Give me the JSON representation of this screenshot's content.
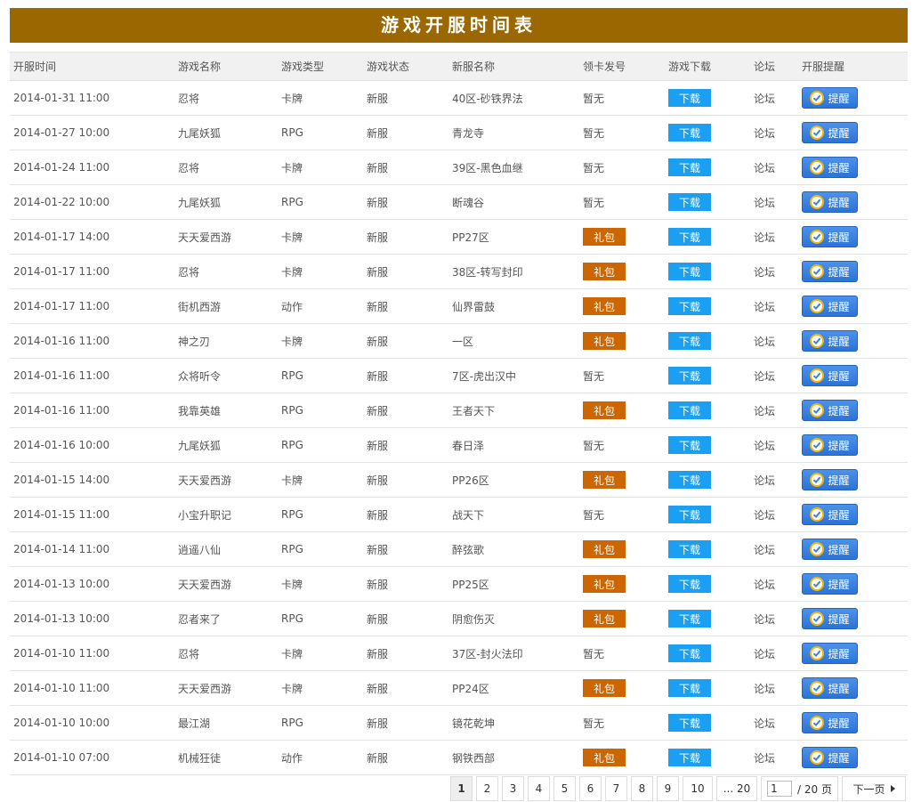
{
  "title": "游戏开服时间表",
  "columns": [
    "开服时间",
    "游戏名称",
    "游戏类型",
    "游戏状态",
    "新服名称",
    "领卡发号",
    "游戏下载",
    "论坛",
    "开服提醒"
  ],
  "labels": {
    "none": "暂无",
    "gift": "礼包",
    "download": "下载",
    "forum": "论坛",
    "remind": "提醒"
  },
  "rows": [
    {
      "time": "2014-01-31 11:00",
      "game": "忍将",
      "type": "卡牌",
      "status": "新服",
      "server": "40区-砂铁界法",
      "card": "none"
    },
    {
      "time": "2014-01-27 10:00",
      "game": "九尾妖狐",
      "type": "RPG",
      "status": "新服",
      "server": "青龙寺",
      "card": "none"
    },
    {
      "time": "2014-01-24 11:00",
      "game": "忍将",
      "type": "卡牌",
      "status": "新服",
      "server": "39区-黑色血继",
      "card": "none"
    },
    {
      "time": "2014-01-22 10:00",
      "game": "九尾妖狐",
      "type": "RPG",
      "status": "新服",
      "server": "断魂谷",
      "card": "none"
    },
    {
      "time": "2014-01-17 14:00",
      "game": "天天爱西游",
      "type": "卡牌",
      "status": "新服",
      "server": "PP27区",
      "card": "gift"
    },
    {
      "time": "2014-01-17 11:00",
      "game": "忍将",
      "type": "卡牌",
      "status": "新服",
      "server": "38区-转写封印",
      "card": "gift"
    },
    {
      "time": "2014-01-17 11:00",
      "game": "街机西游",
      "type": "动作",
      "status": "新服",
      "server": "仙界雷鼓",
      "card": "gift"
    },
    {
      "time": "2014-01-16 11:00",
      "game": "神之刃",
      "type": "卡牌",
      "status": "新服",
      "server": "一区",
      "card": "gift"
    },
    {
      "time": "2014-01-16 11:00",
      "game": "众将听令",
      "type": "RPG",
      "status": "新服",
      "server": "7区-虎出汉中",
      "card": "none"
    },
    {
      "time": "2014-01-16 11:00",
      "game": "我靠英雄",
      "type": "RPG",
      "status": "新服",
      "server": "王者天下",
      "card": "gift"
    },
    {
      "time": "2014-01-16 10:00",
      "game": "九尾妖狐",
      "type": "RPG",
      "status": "新服",
      "server": "春日泽",
      "card": "none"
    },
    {
      "time": "2014-01-15 14:00",
      "game": "天天爱西游",
      "type": "卡牌",
      "status": "新服",
      "server": "PP26区",
      "card": "gift"
    },
    {
      "time": "2014-01-15 11:00",
      "game": "小宝升职记",
      "type": "RPG",
      "status": "新服",
      "server": "战天下",
      "card": "none"
    },
    {
      "time": "2014-01-14 11:00",
      "game": "逍遥八仙",
      "type": "RPG",
      "status": "新服",
      "server": "醉弦歌",
      "card": "gift"
    },
    {
      "time": "2014-01-13 10:00",
      "game": "天天爱西游",
      "type": "卡牌",
      "status": "新服",
      "server": "PP25区",
      "card": "gift"
    },
    {
      "time": "2014-01-13 10:00",
      "game": "忍者来了",
      "type": "RPG",
      "status": "新服",
      "server": "阴愈伤灭",
      "card": "gift"
    },
    {
      "time": "2014-01-10 11:00",
      "game": "忍将",
      "type": "卡牌",
      "status": "新服",
      "server": "37区-封火法印",
      "card": "none"
    },
    {
      "time": "2014-01-10 11:00",
      "game": "天天爱西游",
      "type": "卡牌",
      "status": "新服",
      "server": "PP24区",
      "card": "gift"
    },
    {
      "time": "2014-01-10 10:00",
      "game": "最江湖",
      "type": "RPG",
      "status": "新服",
      "server": "镜花乾坤",
      "card": "none"
    },
    {
      "time": "2014-01-10 07:00",
      "game": "机械狂徒",
      "type": "动作",
      "status": "新服",
      "server": "钢铁西部",
      "card": "gift"
    }
  ],
  "pagination": {
    "pages": [
      "1",
      "2",
      "3",
      "4",
      "5",
      "6",
      "7",
      "8",
      "9",
      "10"
    ],
    "current": "1",
    "last": "... 20",
    "input_value": "1",
    "total_text": "/ 20 页",
    "next_label": "下一页"
  },
  "colors": {
    "title_bg": "#9a6700",
    "gift_bg": "#cc6600",
    "download_bg": "#1a9ff2",
    "remind_bg": "#3a82e4"
  },
  "icons": {
    "remind": "check-circle-icon",
    "next": "triangle-right-icon"
  }
}
